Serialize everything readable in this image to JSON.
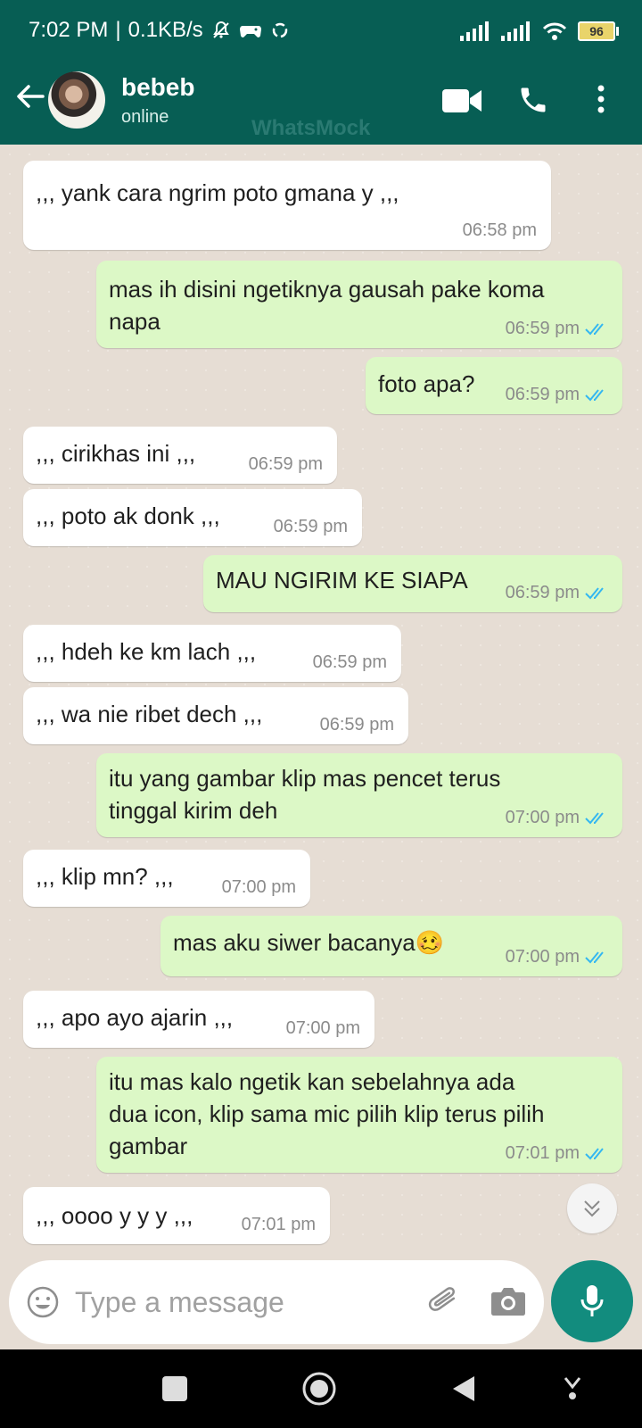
{
  "status_bar": {
    "time": "7:02 PM",
    "network_speed": "0.1KB/s",
    "battery": "96"
  },
  "header": {
    "contact_name": "bebeb",
    "contact_status": "online",
    "watermark": "WhatsMock",
    "icons": [
      "back-arrow-icon",
      "video-call-icon",
      "phone-icon",
      "more-options-icon"
    ]
  },
  "messages": [
    {
      "dir": "in",
      "lines": [
        ",,, yank cara ngrim poto gmana y ,,,"
      ],
      "time": "06:58 pm"
    },
    {
      "dir": "out",
      "lines": [
        "mas ih disini ngetiknya gausah pake koma",
        "napa"
      ],
      "time": "06:59 pm",
      "status": "read"
    },
    {
      "dir": "out",
      "lines": [
        "foto apa?"
      ],
      "time": "06:59 pm",
      "status": "read"
    },
    {
      "dir": "in",
      "lines": [
        ",,, cirikhas ini ,,,"
      ],
      "time": "06:59 pm"
    },
    {
      "dir": "in",
      "lines": [
        ",,, poto ak donk ,,,"
      ],
      "time": "06:59 pm"
    },
    {
      "dir": "out",
      "lines": [
        "MAU NGIRIM KE SIAPA"
      ],
      "time": "06:59 pm",
      "status": "read"
    },
    {
      "dir": "in",
      "lines": [
        ",,, hdeh ke km lach ,,,"
      ],
      "time": "06:59 pm"
    },
    {
      "dir": "in",
      "lines": [
        ",,, wa nie ribet dech ,,,"
      ],
      "time": "06:59 pm"
    },
    {
      "dir": "out",
      "lines": [
        "itu yang gambar klip mas pencet terus",
        "tinggal kirim deh"
      ],
      "time": "07:00 pm",
      "status": "read"
    },
    {
      "dir": "in",
      "lines": [
        ",,, klip mn? ,,,"
      ],
      "time": "07:00 pm"
    },
    {
      "dir": "out",
      "lines": [
        "mas aku siwer bacanya🥴"
      ],
      "time": "07:00 pm",
      "status": "read"
    },
    {
      "dir": "in",
      "lines": [
        ",,, apo ayo ajarin ,,,"
      ],
      "time": "07:00 pm"
    },
    {
      "dir": "out",
      "lines": [
        "itu mas kalo ngetik kan sebelahnya ada",
        "dua icon, klip sama mic pilih klip terus pilih",
        "gambar"
      ],
      "time": "07:01 pm",
      "status": "read"
    },
    {
      "dir": "in",
      "lines": [
        ",,, oooo y y y ,,,"
      ],
      "time": "07:01 pm"
    }
  ],
  "input": {
    "placeholder": "Type a message"
  },
  "colors": {
    "header": "#075e54",
    "outgoing_bubble": "#dcf8c6",
    "incoming_bubble": "#ffffff",
    "read_ticks": "#34b7f1",
    "mic_button": "#128c7e",
    "chat_background": "#e6ddd4"
  },
  "nav_icons": [
    "recent-apps-icon",
    "home-icon",
    "back-icon",
    "assistant-icon"
  ]
}
